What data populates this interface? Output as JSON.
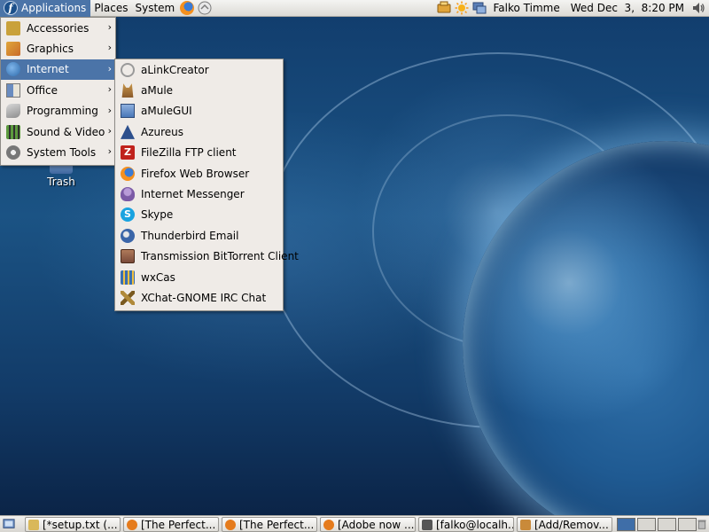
{
  "top_panel": {
    "applications_label": "Applications",
    "places_label": "Places",
    "system_label": "System",
    "user_name": "Falko Timme",
    "clock": "Wed Dec  3,  8:20 PM",
    "icons": [
      "fedora-icon",
      "firefox-icon",
      "mail-notify-icon",
      "update-icon",
      "weather-icon",
      "network-icon",
      "volume-icon"
    ]
  },
  "desktop": {
    "trash_label": "Trash"
  },
  "applications_menu": {
    "items": [
      {
        "label": "Accessories",
        "icon": "accessories-icon",
        "color": "#c9a13a"
      },
      {
        "label": "Graphics",
        "icon": "graphics-icon",
        "color": "#c96b2a"
      },
      {
        "label": "Internet",
        "icon": "internet-globe-icon",
        "color": "#3b7fc4"
      },
      {
        "label": "Office",
        "icon": "office-icon",
        "color": "#6a8cc0"
      },
      {
        "label": "Programming",
        "icon": "programming-icon",
        "color": "#8d8d8d"
      },
      {
        "label": "Sound & Video",
        "icon": "sound-video-icon",
        "color": "#5c9a3e"
      },
      {
        "label": "System Tools",
        "icon": "system-tools-icon",
        "color": "#777777"
      }
    ],
    "selected": "Internet"
  },
  "internet_submenu": {
    "items": [
      {
        "label": "aLinkCreator",
        "icon": "alinkcreator-icon",
        "color": "#9a9a9a"
      },
      {
        "label": "aMule",
        "icon": "amule-icon",
        "color": "#8a5a2b"
      },
      {
        "label": "aMuleGUI",
        "icon": "amulegui-icon",
        "color": "#4a78b8"
      },
      {
        "label": "Azureus",
        "icon": "azureus-icon",
        "color": "#2c4f8c"
      },
      {
        "label": "FileZilla FTP client",
        "icon": "filezilla-icon",
        "color": "#c0221c"
      },
      {
        "label": "Firefox Web Browser",
        "icon": "firefox-icon",
        "color": "#e57b1c"
      },
      {
        "label": "Internet Messenger",
        "icon": "messenger-icon",
        "color": "#7b5aa6"
      },
      {
        "label": "Skype",
        "icon": "skype-icon",
        "color": "#19a3e0"
      },
      {
        "label": "Thunderbird Email",
        "icon": "thunderbird-icon",
        "color": "#3a65a8"
      },
      {
        "label": "Transmission BitTorrent Client",
        "icon": "transmission-icon",
        "color": "#7a4a3a"
      },
      {
        "label": "wxCas",
        "icon": "wxcas-icon",
        "color": "#3a6fb0"
      },
      {
        "label": "XChat-GNOME IRC Chat",
        "icon": "xchat-icon",
        "color": "#b08a3a"
      }
    ]
  },
  "taskbar": {
    "tasks": [
      {
        "label": "[*setup.txt (...",
        "icon": "text-editor-icon",
        "color": "#d9b85a"
      },
      {
        "label": "[The Perfect...",
        "icon": "firefox-icon",
        "color": "#e57b1c"
      },
      {
        "label": "[The Perfect...",
        "icon": "firefox-icon",
        "color": "#e57b1c"
      },
      {
        "label": "[Adobe now ...",
        "icon": "firefox-icon",
        "color": "#e57b1c"
      },
      {
        "label": "[falko@localh...",
        "icon": "terminal-icon",
        "color": "#555555"
      },
      {
        "label": "[Add/Remov...",
        "icon": "package-icon",
        "color": "#c98a3a"
      }
    ],
    "workspaces": 4,
    "active_workspace": 1
  }
}
